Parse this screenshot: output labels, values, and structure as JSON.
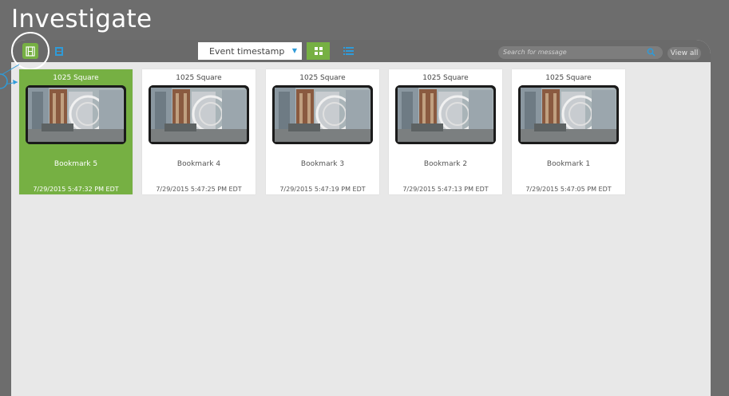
{
  "page": {
    "title": "Investigate"
  },
  "toolbar": {
    "sort_label": "Event timestamp",
    "search_placeholder": "Search for message",
    "view_all_label": "View all"
  },
  "colors": {
    "accent": "#76b043",
    "link": "#2f9bd8"
  },
  "cards": [
    {
      "camera": "1025 Square",
      "bookmark": "Bookmark 5",
      "timestamp": "7/29/2015 5:47:32 PM EDT",
      "selected": true
    },
    {
      "camera": "1025 Square",
      "bookmark": "Bookmark 4",
      "timestamp": "7/29/2015 5:47:25 PM EDT",
      "selected": false
    },
    {
      "camera": "1025 Square",
      "bookmark": "Bookmark 3",
      "timestamp": "7/29/2015 5:47:19 PM EDT",
      "selected": false
    },
    {
      "camera": "1025 Square",
      "bookmark": "Bookmark 2",
      "timestamp": "7/29/2015 5:47:13 PM EDT",
      "selected": false
    },
    {
      "camera": "1025 Square",
      "bookmark": "Bookmark 1",
      "timestamp": "7/29/2015 5:47:05 PM EDT",
      "selected": false
    }
  ],
  "icons": {
    "bookmarks_tab": "film-icon",
    "cameras_tab": "camera-film-icon",
    "grid_view": "grid-icon",
    "list_view": "list-icon",
    "search": "search-icon"
  }
}
